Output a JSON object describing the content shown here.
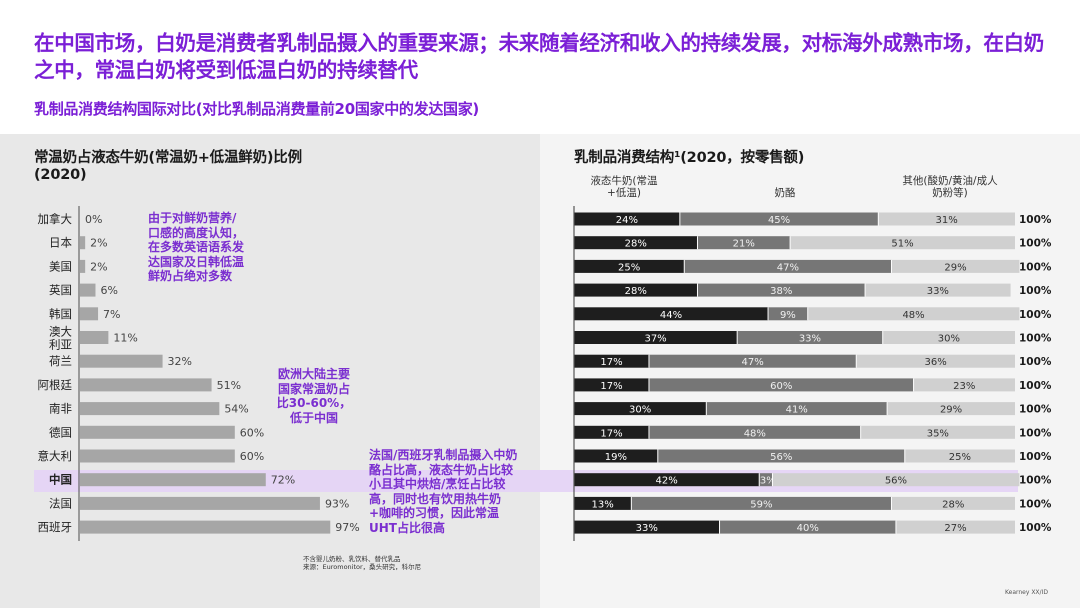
{
  "header": {
    "title": "在中国市场，白奶是消费者乳制品摄入的重要来源；未来随着经济和收入的持续发展，对标海外成熟市场，在白奶之中，常温白奶将受到低温白奶的持续替代",
    "subtitle": "乳制品消费结构国际对比(对比乳制品消费量前20国家中的发达国家)"
  },
  "colors": {
    "accent": "#7b1fd6",
    "highlight": "#e4d3f6",
    "left_bar": "#a6a6a6",
    "liquid_milk": "#1e1e1e",
    "cheese": "#767676",
    "other": "#d0d0d0"
  },
  "annotations": {
    "note1": "由于对鲜奶营养/口感的高度认知，在多数英语语系发达国家及日韩低温鲜奶占绝对多数",
    "note2": "欧洲大陆主要国家常温奶占比30-60%，低于中国",
    "note3": "法国/西班牙乳制品摄入中奶酪占比高，液态牛奶占比较小且其中烘焙/烹饪占比较高，同时也有饮用热牛奶+咖啡的习惯，因此常温UHT占比很高"
  },
  "footnote": {
    "line1": "不含婴儿奶粉、乳饮料、替代乳品",
    "line2": "来源：Euromonitor，桑头研究，科尔尼"
  },
  "brand": "Kearney XX/ID",
  "highlighted_country": "中国",
  "chart_data": [
    {
      "type": "bar",
      "orientation": "horizontal",
      "title": "常温奶占液态牛奶(常温奶+低温鲜奶)比例(2020)",
      "categories": [
        "加拿大",
        "日本",
        "美国",
        "英国",
        "韩国",
        "澳大利亚",
        "荷兰",
        "阿根廷",
        "南非",
        "德国",
        "意大利",
        "中国",
        "法国",
        "西班牙"
      ],
      "values": [
        0,
        2,
        2,
        6,
        7,
        11,
        32,
        51,
        54,
        60,
        60,
        72,
        93,
        97
      ],
      "labels": [
        "0%",
        "2%",
        "2%",
        "6%",
        "7%",
        "11%",
        "32%",
        "51%",
        "54%",
        "60%",
        "60%",
        "72%",
        "93%",
        "97%"
      ],
      "unit": "%",
      "xlim": [
        0,
        100
      ],
      "grid": false
    },
    {
      "type": "bar",
      "orientation": "horizontal",
      "stacked": true,
      "title": "乳制品消费结构¹(2020，按零售额)",
      "categories": [
        "加拿大",
        "日本",
        "美国",
        "英国",
        "韩国",
        "澳大利亚",
        "荷兰",
        "阿根廷",
        "南非",
        "德国",
        "意大利",
        "中国",
        "法国",
        "西班牙"
      ],
      "series": [
        {
          "name": "液态牛奶(常温+低温)",
          "values": [
            24,
            28,
            25,
            28,
            44,
            37,
            17,
            17,
            30,
            17,
            19,
            42,
            13,
            33
          ]
        },
        {
          "name": "奶酪",
          "values": [
            45,
            21,
            47,
            38,
            9,
            33,
            47,
            60,
            41,
            48,
            56,
            3,
            59,
            40
          ]
        },
        {
          "name": "其他(酸奶/黄油/成人奶粉等)",
          "values": [
            31,
            51,
            29,
            33,
            48,
            30,
            36,
            23,
            29,
            35,
            25,
            56,
            28,
            27
          ]
        }
      ],
      "totals": [
        "100%",
        "100%",
        "100%",
        "100%",
        "100%",
        "100%",
        "100%",
        "100%",
        "100%",
        "100%",
        "100%",
        "100%",
        "100%",
        "100%"
      ],
      "unit": "%",
      "xlim": [
        0,
        100
      ],
      "legend": "top"
    }
  ]
}
